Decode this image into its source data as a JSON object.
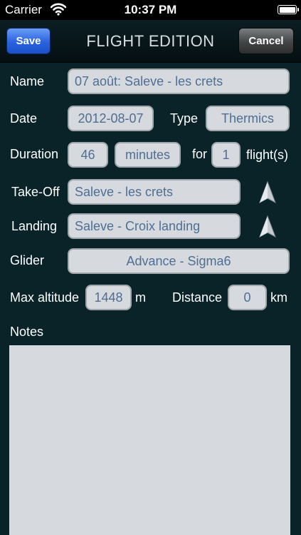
{
  "status": {
    "carrier": "Carrier",
    "time": "10:37 PM"
  },
  "nav": {
    "save": "Save",
    "title": "FLIGHT EDITION",
    "cancel": "Cancel"
  },
  "form": {
    "name_label": "Name",
    "name_value": "07 août: Saleve - les crets",
    "date_label": "Date",
    "date_value": "2012-08-07",
    "type_label": "Type",
    "type_value": "Thermics",
    "duration_label": "Duration",
    "duration_value": "46",
    "duration_unit": "minutes",
    "for_label": "for",
    "flights_value": "1",
    "flights_label": "flight(s)",
    "takeoff_label": "Take-Off",
    "takeoff_value": "Saleve - les crets",
    "landing_label": "Landing",
    "landing_value": "Saleve - Croix landing",
    "glider_label": "Glider",
    "glider_value": "Advance - Sigma6",
    "maxalt_label": "Max altitude",
    "maxalt_value": "1448",
    "maxalt_unit": "m",
    "distance_label": "Distance",
    "distance_value": "0",
    "distance_unit": "km",
    "notes_label": "Notes"
  },
  "icons": {
    "wifi": "wifi-icon",
    "battery": "battery-icon",
    "takeoff_locate": "location-arrow-icon",
    "landing_locate": "location-arrow-icon"
  }
}
